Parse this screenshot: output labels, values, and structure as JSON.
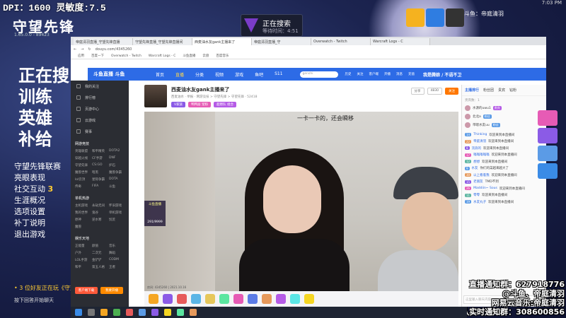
{
  "overlay": {
    "dpi_text": "DPI：1600 灵敏度:7.5",
    "game_logo": "守望先锋",
    "game_version": "1.65.0.0 - 89423",
    "big_menu": [
      "正在搜",
      "训练",
      "英雄",
      "补给"
    ],
    "small_menu": [
      "守望先锋联赛",
      "亮眼表现",
      "社交互动",
      "生涯概况",
      "选项设置",
      "补丁说明",
      "退出游戏"
    ],
    "social_badge": "3",
    "friends_online": "• 3 位好友正在玩《守望",
    "bottom_note": "按下回答开始聊天",
    "search_title": "正在搜索",
    "search_wait": "等待时间：4:51",
    "stream_title": "斗鱼：帝庭清羽",
    "system_time": "7:03 PM",
    "notice_1": "直播通知群：627918776",
    "notice_2": "@斗鱼、帝庭清羽",
    "notice_3": "网易云音乐:帝庭清羽",
    "notice_4": "排队实时通知群：308600856"
  },
  "browser": {
    "tabs": [
      "帝庭清羽直播_守望先锋直播",
      "守望先锋直播_守望先锋直播间",
      "西麦油水友gank主播来了",
      "帝庭清羽直播_守",
      "Overwatch - Twitch",
      "Warcraft Logs - C"
    ],
    "url": "douyu.com/4345260",
    "bookmarks": [
      "应用",
      "百度一下",
      "Overwatch - Twitch",
      "Warcraft Logs - C",
      "斗鱼直播",
      "云盘",
      "百度音乐"
    ]
  },
  "douyu": {
    "logo": "斗鱼直播 斗鱼",
    "nav": [
      "首页",
      "直播",
      "分类",
      "视频",
      "游戏",
      "鱼吧",
      "S11"
    ],
    "active_nav": "直播",
    "search_placeholder": "genshi",
    "header_icons": [
      "历史",
      "关注",
      "客户端",
      "开播",
      "消息",
      "充值"
    ],
    "login": "我是腾娘 / 不语不卫",
    "sidebar": {
      "items": [
        "我的关注",
        "排行榜",
        "页游中心",
        "云游戏",
        "赛事"
      ],
      "sections": [
        {
          "title": "网游竞技",
          "cats": [
            "英雄联盟",
            "和平精英",
            "DOTA2",
            "穿越火线",
            "CF手游",
            "DNF",
            "守望先锋",
            "CS:GO",
            "炉石",
            "魔兽世界",
            "暗黑",
            "魔兽争霸",
            "lol云顶",
            "星际争霸",
            "DOTA",
            "传奇",
            "FIFA",
            "斗鱼"
          ]
        },
        {
          "title": "单机热游",
          "cats": [
            "主机游戏",
            "永劫无间",
            "怀旧游戏",
            "我的世界",
            "鬼谷",
            "单机游戏",
            "原神",
            "逆水寒",
            "饥荒",
            "魔兽"
          ]
        },
        {
          "title": "娱乐天地",
          "cats": [
            "正能量",
            "颜值",
            "音乐",
            "户外",
            "二次元",
            "舞蹈",
            "LOL手游",
            "金铲铲",
            "CODM",
            "和平",
            "第五人格",
            "王者"
          ]
        }
      ],
      "btn_1": "客户端下载",
      "btn_2": "我要开播"
    },
    "room": {
      "title": "西麦油水友gank主播来了",
      "meta": "举报 · 网游竞技 > 守望先锋 > 守望先锋",
      "anchor_name": "西麦油水",
      "heat": "52418",
      "tags": [
        "V家族",
        "鸭鸭居 宠粉",
        "超燃队 组合"
      ],
      "actions": [
        "分享",
        "4830",
        "关注"
      ]
    },
    "video": {
      "caption": "一卡一卡的，还会瞬移",
      "badge_top": "斗鱼直播",
      "badge_count": "291/9999",
      "footer": "房间: 4345260 | 2021.10.16"
    },
    "chat": {
      "tabs": [
        "主播排行",
        "粉丝团",
        "贵宾",
        "钻粉"
      ],
      "rank_title": "贵宾数：1",
      "rank": [
        {
          "name": "水源的uwu1",
          "lv": "贵宾"
        },
        {
          "name": "北北a",
          "lv": "粉丝"
        },
        {
          "name": "带嗯水友uu",
          "lv": "粉丝"
        }
      ],
      "messages": [
        {
          "lv": "14",
          "user": "Thinking",
          "text": "欢迎来到本直播间"
        },
        {
          "lv": "22",
          "user": "帝庭清羽",
          "text": "欢迎来到本直播间"
        },
        {
          "lv": "8",
          "user": "流浪的",
          "text": "欢迎来到本直播间"
        },
        {
          "lv": "17",
          "user": "嗡嗡嗡嗡嗡",
          "text": "欢迎来到本直播间"
        },
        {
          "lv": "12",
          "user": "想想",
          "text": "欢迎来到本直播间"
        },
        {
          "lv": "9",
          "user": "水友",
          "text": "你们的菜越来越大了"
        },
        {
          "lv": "30",
          "user": "以上看着我",
          "text": "欢迎来到本直播间"
        },
        {
          "lv": "15",
          "user": "老朋友",
          "text": "TMD不到"
        },
        {
          "lv": "26",
          "user": "Maddiin~ Sous",
          "text": "欢迎来到本直播间"
        },
        {
          "lv": "11",
          "user": "零零",
          "text": "欢迎来到本直播间"
        },
        {
          "lv": "19",
          "user": "水友丸子",
          "text": "欢迎来到本直播间"
        }
      ],
      "input_placeholder": "这里输入聊天内容"
    }
  },
  "colors": {
    "douyu_blue": "#2d6be6",
    "accent_orange": "#ff7700",
    "game_yellow": "#ffcc33"
  }
}
